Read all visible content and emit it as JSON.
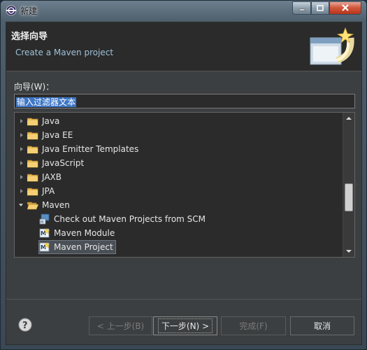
{
  "window": {
    "title": "新建"
  },
  "header": {
    "title": "选择向导",
    "description": "Create a Maven project"
  },
  "filter": {
    "label": "向导(W)：",
    "value": "输入过滤器文本"
  },
  "tree": {
    "items": [
      {
        "label": "Java",
        "state": "closed",
        "level": 0,
        "icon": "folder-icon"
      },
      {
        "label": "Java EE",
        "state": "closed",
        "level": 0,
        "icon": "folder-icon"
      },
      {
        "label": "Java Emitter Templates",
        "state": "closed",
        "level": 0,
        "icon": "folder-icon"
      },
      {
        "label": "JavaScript",
        "state": "closed",
        "level": 0,
        "icon": "folder-icon"
      },
      {
        "label": "JAXB",
        "state": "closed",
        "level": 0,
        "icon": "folder-icon"
      },
      {
        "label": "JPA",
        "state": "closed",
        "level": 0,
        "icon": "folder-icon"
      },
      {
        "label": "Maven",
        "state": "open",
        "level": 0,
        "icon": "folder-open-icon"
      },
      {
        "label": "Check out Maven Projects from SCM",
        "level": 1,
        "icon": "scm-checkout-icon"
      },
      {
        "label": "Maven Module",
        "level": 1,
        "icon": "maven-module-icon"
      },
      {
        "label": "Maven Project",
        "level": 1,
        "icon": "maven-project-icon",
        "selected": true
      }
    ]
  },
  "buttons": {
    "back": "< 上一步(B)",
    "next": "下一步(N) >",
    "finish": "完成(F)",
    "cancel": "取消"
  },
  "colors": {
    "dialog_bg": "#3c3f41",
    "header_bg": "#2b2b2b",
    "description": "#9ec2d8",
    "selection": "#3d76c6"
  }
}
